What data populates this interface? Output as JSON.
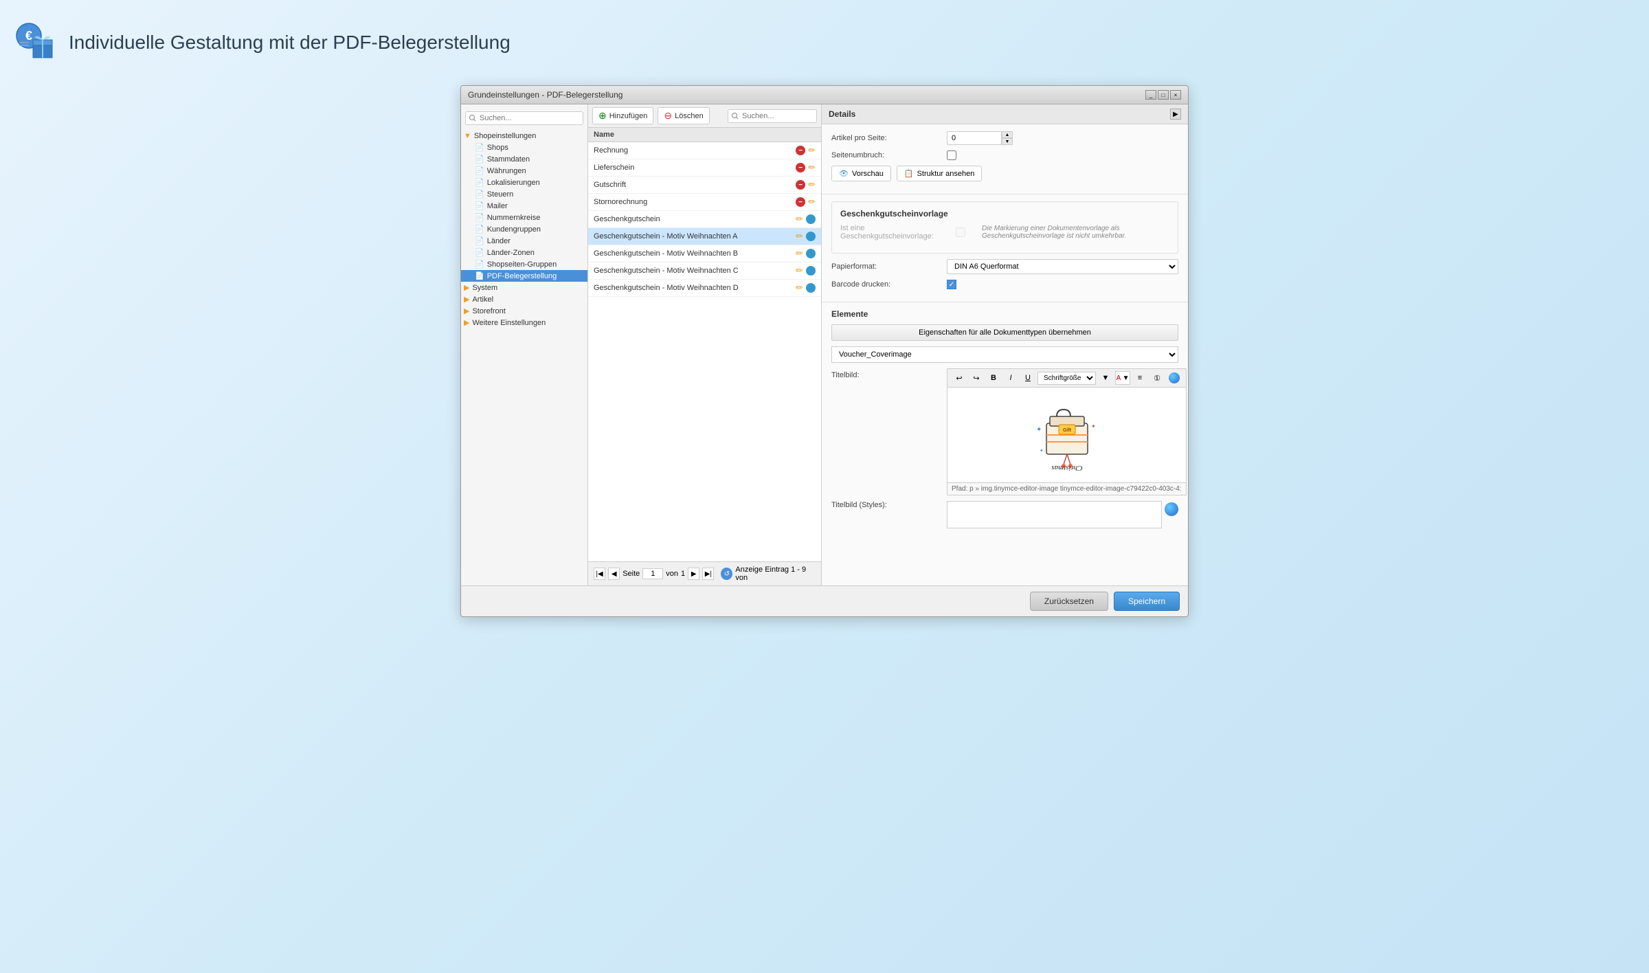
{
  "page": {
    "title": "Individuelle Gestaltung mit der PDF-Belegerstellung"
  },
  "window": {
    "title": "Grundeinstellungen - PDF-Belegerstellung"
  },
  "sidebar": {
    "search_placeholder": "Suchen...",
    "tree": [
      {
        "id": "shopeinstellungen",
        "label": "Shopeinstellungen",
        "level": "group",
        "type": "folder",
        "expanded": true
      },
      {
        "id": "shops",
        "label": "Shops",
        "level": "level1",
        "type": "file"
      },
      {
        "id": "stammdaten",
        "label": "Stammdaten",
        "level": "level1",
        "type": "file"
      },
      {
        "id": "waehrungen",
        "label": "Währungen",
        "level": "level1",
        "type": "file"
      },
      {
        "id": "lokalisierungen",
        "label": "Lokalisierungen",
        "level": "level1",
        "type": "file"
      },
      {
        "id": "steuern",
        "label": "Steuern",
        "level": "level1",
        "type": "file"
      },
      {
        "id": "mailer",
        "label": "Mailer",
        "level": "level1",
        "type": "file"
      },
      {
        "id": "nummernkreise",
        "label": "Nummernkreise",
        "level": "level1",
        "type": "file"
      },
      {
        "id": "kundengruppen",
        "label": "Kundengruppen",
        "level": "level1",
        "type": "file"
      },
      {
        "id": "laender",
        "label": "Länder",
        "level": "level1",
        "type": "file"
      },
      {
        "id": "laender-zonen",
        "label": "Länder-Zonen",
        "level": "level1",
        "type": "file"
      },
      {
        "id": "shopseiten-gruppen",
        "label": "Shopseiten-Gruppen",
        "level": "level1",
        "type": "file"
      },
      {
        "id": "pdf-belegerstellung",
        "label": "PDF-Belegerstellung",
        "level": "level1",
        "type": "file",
        "active": true
      },
      {
        "id": "system",
        "label": "System",
        "level": "group",
        "type": "folder",
        "expanded": false
      },
      {
        "id": "artikel",
        "label": "Artikel",
        "level": "group",
        "type": "folder",
        "expanded": false
      },
      {
        "id": "storefront",
        "label": "Storefront",
        "level": "group",
        "type": "folder",
        "expanded": false
      },
      {
        "id": "weitere-einstellungen",
        "label": "Weitere Einstellungen",
        "level": "group",
        "type": "folder",
        "expanded": false
      }
    ]
  },
  "toolbar": {
    "add_label": "Hinzufügen",
    "delete_label": "Löschen",
    "search_placeholder": "Suchen..."
  },
  "list": {
    "column_name": "Name",
    "items": [
      {
        "id": 1,
        "name": "Rechnung",
        "has_red": true,
        "has_edit": true,
        "has_blue": false
      },
      {
        "id": 2,
        "name": "Lieferschein",
        "has_red": true,
        "has_edit": true,
        "has_blue": false
      },
      {
        "id": 3,
        "name": "Gutschrift",
        "has_red": true,
        "has_edit": true,
        "has_blue": false
      },
      {
        "id": 4,
        "name": "Stornorechnung",
        "has_red": true,
        "has_edit": true,
        "has_blue": false
      },
      {
        "id": 5,
        "name": "Geschenkgutschein",
        "has_red": false,
        "has_edit": true,
        "has_blue": true
      },
      {
        "id": 6,
        "name": "Geschenkgutschein - Motiv Weihnachten A",
        "has_red": false,
        "has_edit": true,
        "has_blue": true,
        "selected": true
      },
      {
        "id": 7,
        "name": "Geschenkgutschein - Motiv Weihnachten B",
        "has_red": false,
        "has_edit": true,
        "has_blue": true
      },
      {
        "id": 8,
        "name": "Geschenkgutschein - Motiv Weihnachten C",
        "has_red": false,
        "has_edit": true,
        "has_blue": true
      },
      {
        "id": 9,
        "name": "Geschenkgutschein - Motiv Weihnachten D",
        "has_red": false,
        "has_edit": true,
        "has_blue": true
      }
    ]
  },
  "pagination": {
    "page_label": "Seite",
    "current_page": "1",
    "of_label": "von",
    "total_pages": "1",
    "display_label": "Anzeige Eintrag 1 - 9 von"
  },
  "details": {
    "header": "Details",
    "artikel_pro_seite_label": "Artikel pro Seite:",
    "artikel_pro_seite_value": "0",
    "seitenumbruch_label": "Seitenumbruch:",
    "vorschau_label": "Vorschau",
    "struktur_label": "Struktur ansehen",
    "geschenkvorlage_title": "Geschenkgutscheinvorlage",
    "ist_vorlage_label": "Ist eine Geschenkgutscheinvorlage:",
    "ist_vorlage_note": "Die Markierung einer Dokumentenvorlage als Geschenkgutscheinvorlage ist nicht umkehrbar.",
    "papierformat_label": "Papierformat:",
    "papierformat_value": "DIN A6 Querformat",
    "barcode_label": "Barcode drucken:",
    "elemente_title": "Elemente",
    "eigenschaften_btn": "Eigenschaften für alle Dokumenttypen übernehmen",
    "voucher_dropdown": "Voucher_Coverimage",
    "titelbild_label": "Titelbild:",
    "titelbild_styles_label": "Titelbild (Styles):",
    "editor_path": "Pfad: p » img.tinymce-editor-image tinymce-editor-image-c79422c0-403c-4:",
    "reset_label": "Zurücksetzen",
    "save_label": "Speichern",
    "fontsize_label": "Schriftgröße"
  }
}
